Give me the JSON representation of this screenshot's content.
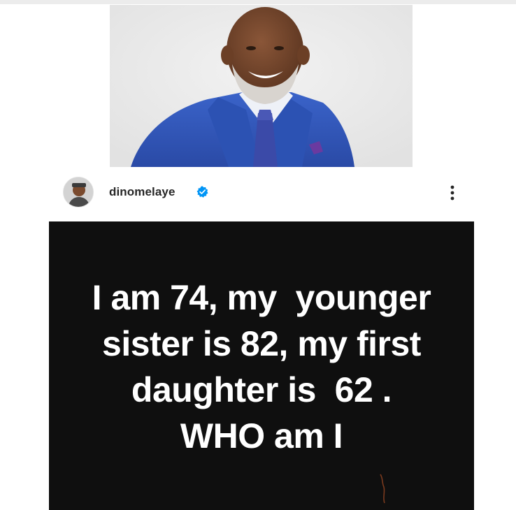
{
  "post": {
    "username": "dinomelaye",
    "verified": true,
    "text_lines": [
      "I am 74, my  younger",
      "sister is 82, my first",
      "daughter is  62 .",
      "WHO am I"
    ]
  },
  "icons": {
    "verified": "verified-badge-icon",
    "more": "more-options-icon"
  },
  "colors": {
    "post_background": "#0f0f0f",
    "post_text": "#ffffff",
    "verified_badge": "#0095f6",
    "username_text": "#262626"
  }
}
